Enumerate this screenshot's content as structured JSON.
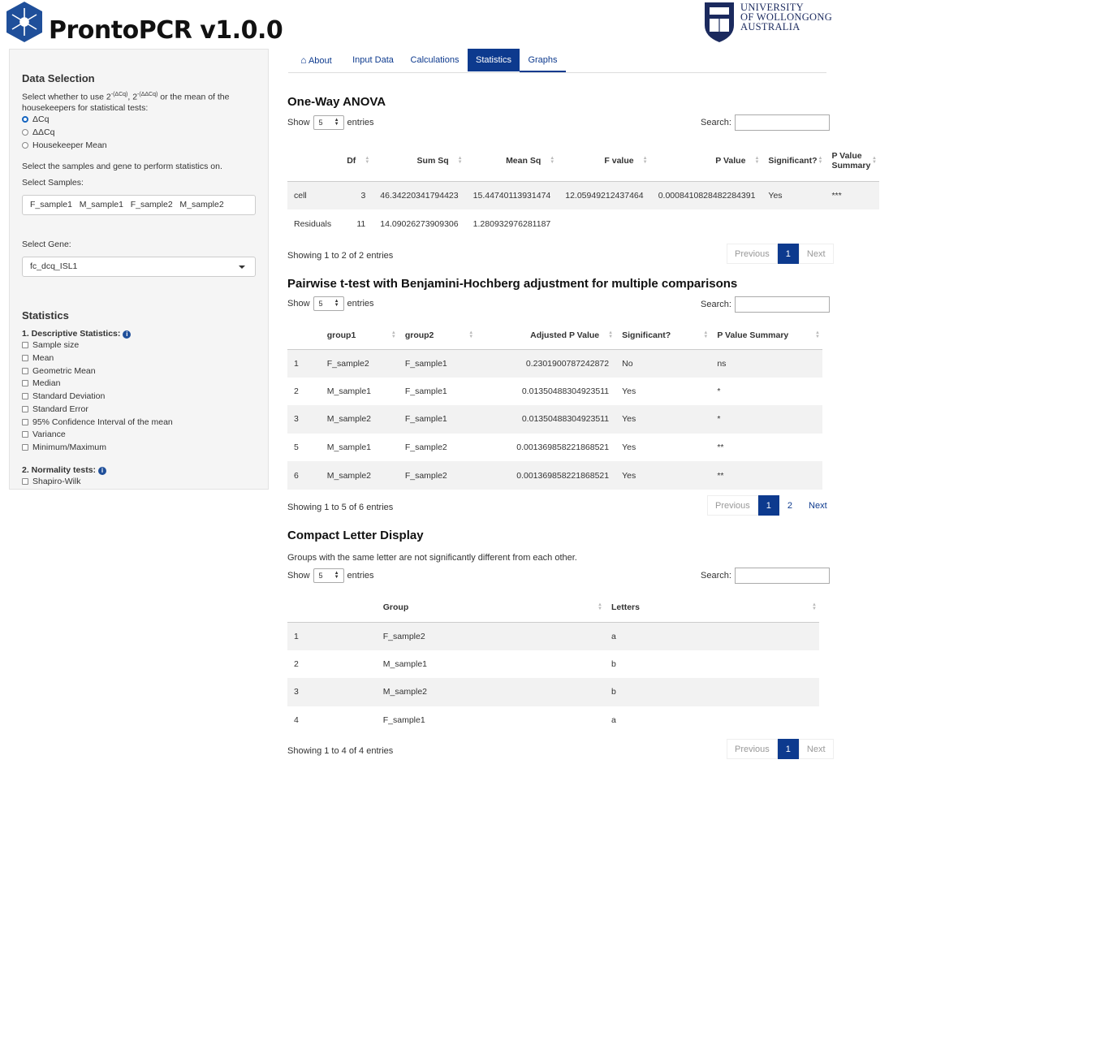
{
  "app": {
    "title": "ProntoPCR v1.0.0"
  },
  "university": {
    "line1": "UNIVERSITY",
    "line2": "OF WOLLONGONG",
    "line3": "AUSTRALIA"
  },
  "tabs": [
    {
      "label": "About",
      "icon": "home-icon"
    },
    {
      "label": "Input Data"
    },
    {
      "label": "Calculations"
    },
    {
      "label": "Statistics",
      "active": true
    },
    {
      "label": "Graphs"
    }
  ],
  "sidebar": {
    "data_selection_heading": "Data Selection",
    "desc_part1": "Select whether to use 2",
    "sup1": "-(ΔCq)",
    "desc_sep": ", 2",
    "sup2": "-(ΔΔCq)",
    "desc_part2": " or the mean of the",
    "desc_line2": "housekeepers for statistical tests:",
    "radios": [
      {
        "label": "ΔCq",
        "checked": true
      },
      {
        "label": "ΔΔCq",
        "checked": false
      },
      {
        "label": "Housekeeper Mean",
        "checked": false
      }
    ],
    "samples_instruction": "Select the samples and gene to perform statistics on.",
    "select_samples_label": "Select Samples:",
    "samples_value": "F_sample1   M_sample1   F_sample2   M_sample2",
    "select_gene_label": "Select Gene:",
    "gene_value": "fc_dcq_ISL1",
    "statistics_heading": "Statistics",
    "descriptive_label": "1. Descriptive Statistics:",
    "descriptive_options": [
      "Sample size",
      "Mean",
      "Geometric Mean",
      "Median",
      "Standard Deviation",
      "Standard Error",
      "95% Confidence Interval of the mean",
      "Variance",
      "Minimum/Maximum"
    ],
    "normality_label": "2. Normality tests:",
    "normality_options": [
      "Shapiro-Wilk"
    ]
  },
  "common": {
    "show": "Show",
    "entries": "entries",
    "length": "5",
    "search": "Search:",
    "previous": "Previous",
    "next": "Next"
  },
  "anova": {
    "title": "One-Way ANOVA",
    "headers": [
      "",
      "Df",
      "Sum Sq",
      "Mean Sq",
      "F value",
      "P Value",
      "Significant?",
      "P Value Summary"
    ],
    "rows": [
      [
        "cell",
        "3",
        "46.34220341794423",
        "15.44740113931474",
        "12.05949212437464",
        "0.0008410828482284391",
        "Yes",
        "***"
      ],
      [
        "Residuals",
        "11",
        "14.09026273909306",
        "1.280932976281187",
        "",
        "",
        "",
        ""
      ]
    ],
    "info": "Showing 1 to 2 of 2 entries",
    "pages": [
      "1"
    ]
  },
  "pairwise": {
    "title": "Pairwise t-test with Benjamini-Hochberg adjustment for multiple comparisons",
    "headers": [
      "",
      "group1",
      "group2",
      "Adjusted P Value",
      "Significant?",
      "P Value Summary"
    ],
    "rows": [
      [
        "1",
        "F_sample2",
        "F_sample1",
        "0.2301900787242872",
        "No",
        "ns"
      ],
      [
        "2",
        "M_sample1",
        "F_sample1",
        "0.01350488304923511",
        "Yes",
        "*"
      ],
      [
        "3",
        "M_sample2",
        "F_sample1",
        "0.01350488304923511",
        "Yes",
        "*"
      ],
      [
        "5",
        "M_sample1",
        "F_sample2",
        "0.001369858221868521",
        "Yes",
        "**"
      ],
      [
        "6",
        "M_sample2",
        "F_sample2",
        "0.001369858221868521",
        "Yes",
        "**"
      ]
    ],
    "info": "Showing 1 to 5 of 6 entries",
    "pages": [
      "1",
      "2"
    ]
  },
  "cld": {
    "title": "Compact Letter Display",
    "note": "Groups with the same letter are not significantly different from each other.",
    "headers": [
      "",
      "Group",
      "Letters"
    ],
    "rows": [
      [
        "1",
        "F_sample2",
        "a"
      ],
      [
        "2",
        "M_sample1",
        "b"
      ],
      [
        "3",
        "M_sample2",
        "b"
      ],
      [
        "4",
        "F_sample1",
        "a"
      ]
    ],
    "info": "Showing 1 to 4 of 4 entries",
    "pages": [
      "1"
    ]
  }
}
